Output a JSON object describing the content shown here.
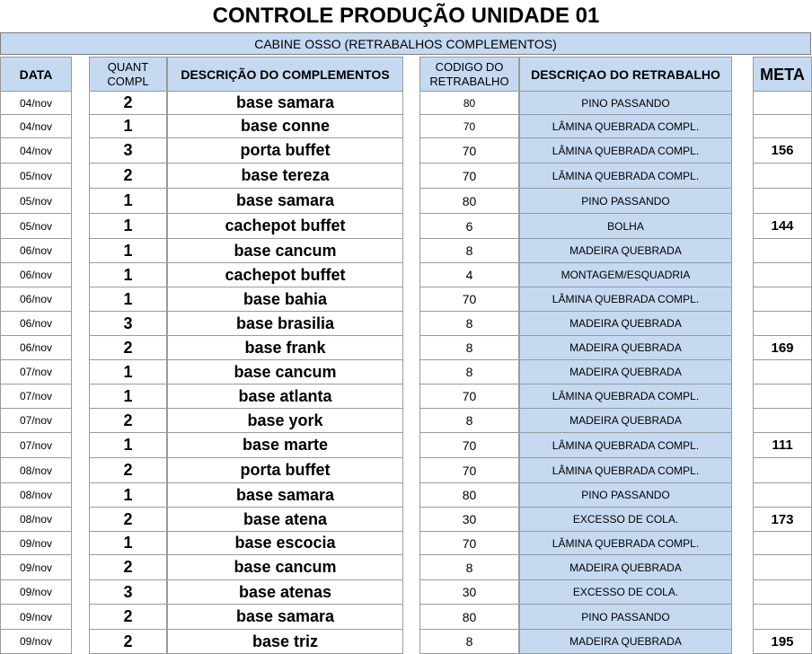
{
  "title": "CONTROLE PRODUÇÃO UNIDADE 01",
  "subtitle": "CABINE OSSO (RETRABALHOS COMPLEMENTOS)",
  "headers": {
    "data": "DATA",
    "quant": "QUANT COMPL",
    "descricao": "DESCRIÇÃO DO COMPLEMENTOS",
    "codigo": "CODIGO DO RETRABALHO",
    "retrabalho": "DESCRIÇAO DO RETRABALHO",
    "meta": "META"
  },
  "rows": [
    {
      "data": "04/nov",
      "quant": "2",
      "descricao": "base samara",
      "codigo": "80",
      "retrabalho": "PINO PASSANDO",
      "meta": ""
    },
    {
      "data": "04/nov",
      "quant": "1",
      "descricao": "base conne",
      "codigo": "70",
      "retrabalho": "LÂMINA QUEBRADA COMPL.",
      "meta": ""
    },
    {
      "data": "04/nov",
      "quant": "3",
      "descricao": "porta buffet",
      "codigo": "70",
      "retrabalho": "LÂMINA QUEBRADA COMPL.",
      "meta": "156"
    },
    {
      "data": "05/nov",
      "quant": "2",
      "descricao": "base tereza",
      "codigo": "70",
      "retrabalho": "LÂMINA QUEBRADA COMPL.",
      "meta": ""
    },
    {
      "data": "05/nov",
      "quant": "1",
      "descricao": "base samara",
      "codigo": "80",
      "retrabalho": "PINO PASSANDO",
      "meta": ""
    },
    {
      "data": "05/nov",
      "quant": "1",
      "descricao": "cachepot buffet",
      "codigo": "6",
      "retrabalho": "BOLHA",
      "meta": "144"
    },
    {
      "data": "06/nov",
      "quant": "1",
      "descricao": "base cancum",
      "codigo": "8",
      "retrabalho": "MADEIRA QUEBRADA",
      "meta": ""
    },
    {
      "data": "06/nov",
      "quant": "1",
      "descricao": "cachepot buffet",
      "codigo": "4",
      "retrabalho": "MONTAGEM/ESQUADRIA",
      "meta": ""
    },
    {
      "data": "06/nov",
      "quant": "1",
      "descricao": "base bahia",
      "codigo": "70",
      "retrabalho": "LÂMINA QUEBRADA COMPL.",
      "meta": ""
    },
    {
      "data": "06/nov",
      "quant": "3",
      "descricao": "base brasilia",
      "codigo": "8",
      "retrabalho": "MADEIRA QUEBRADA",
      "meta": ""
    },
    {
      "data": "06/nov",
      "quant": "2",
      "descricao": "base frank",
      "codigo": "8",
      "retrabalho": "MADEIRA QUEBRADA",
      "meta": "169"
    },
    {
      "data": "07/nov",
      "quant": "1",
      "descricao": "base cancum",
      "codigo": "8",
      "retrabalho": "MADEIRA QUEBRADA",
      "meta": ""
    },
    {
      "data": "07/nov",
      "quant": "1",
      "descricao": "base atlanta",
      "codigo": "70",
      "retrabalho": "LÂMINA QUEBRADA COMPL.",
      "meta": ""
    },
    {
      "data": "07/nov",
      "quant": "2",
      "descricao": "base york",
      "codigo": "8",
      "retrabalho": "MADEIRA QUEBRADA",
      "meta": ""
    },
    {
      "data": "07/nov",
      "quant": "1",
      "descricao": "base marte",
      "codigo": "70",
      "retrabalho": "LÂMINA QUEBRADA COMPL.",
      "meta": "111"
    },
    {
      "data": "08/nov",
      "quant": "2",
      "descricao": "porta buffet",
      "codigo": "70",
      "retrabalho": "LÂMINA QUEBRADA COMPL.",
      "meta": ""
    },
    {
      "data": "08/nov",
      "quant": "1",
      "descricao": "base samara",
      "codigo": "80",
      "retrabalho": "PINO PASSANDO",
      "meta": ""
    },
    {
      "data": "08/nov",
      "quant": "2",
      "descricao": "base atena",
      "codigo": "30",
      "retrabalho": "EXCESSO DE COLA.",
      "meta": "173"
    },
    {
      "data": "09/nov",
      "quant": "1",
      "descricao": "base escocia",
      "codigo": "70",
      "retrabalho": "LÂMINA QUEBRADA COMPL.",
      "meta": ""
    },
    {
      "data": "09/nov",
      "quant": "2",
      "descricao": "base cancum",
      "codigo": "8",
      "retrabalho": "MADEIRA QUEBRADA",
      "meta": ""
    },
    {
      "data": "09/nov",
      "quant": "3",
      "descricao": "base atenas",
      "codigo": "30",
      "retrabalho": "EXCESSO DE COLA.",
      "meta": ""
    },
    {
      "data": "09/nov",
      "quant": "2",
      "descricao": "base samara",
      "codigo": "80",
      "retrabalho": "PINO PASSANDO",
      "meta": ""
    },
    {
      "data": "09/nov",
      "quant": "2",
      "descricao": "base triz",
      "codigo": "8",
      "retrabalho": "MADEIRA QUEBRADA",
      "meta": "195"
    }
  ]
}
